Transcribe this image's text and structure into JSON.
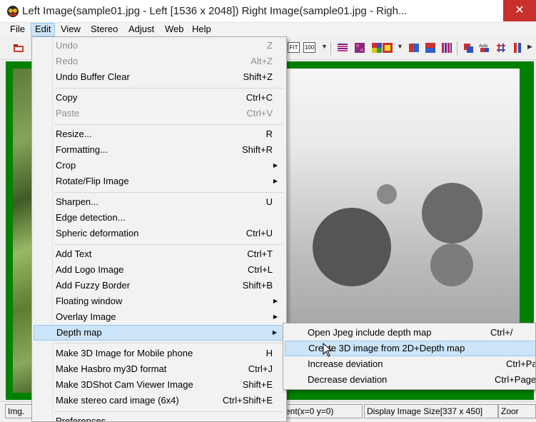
{
  "window": {
    "title": "Left Image(sample01.jpg - Left [1536 x 2048]) Right Image(sample01.jpg - Righ...",
    "close_glyph": "✕"
  },
  "menubar": [
    "File",
    "Edit",
    "View",
    "Stereo",
    "Adjust",
    "Web",
    "Help"
  ],
  "toolbar": {
    "fit_label": "FIT",
    "hundred_label": "100"
  },
  "edit_menu": [
    {
      "label": "Undo",
      "shortcut": "Z",
      "disabled": true
    },
    {
      "label": "Redo",
      "shortcut": "Alt+Z",
      "disabled": true
    },
    {
      "label": "Undo Buffer Clear",
      "shortcut": "Shift+Z"
    },
    {
      "label": "Copy",
      "shortcut": "Ctrl+C"
    },
    {
      "label": "Paste",
      "shortcut": "Ctrl+V",
      "disabled": true
    },
    {
      "label": "Resize...",
      "shortcut": "R"
    },
    {
      "label": "Formatting...",
      "shortcut": "Shift+R"
    },
    {
      "label": "Crop",
      "submenu": true
    },
    {
      "label": "Rotate/Flip Image",
      "submenu": true
    },
    {
      "label": "Sharpen...",
      "shortcut": "U"
    },
    {
      "label": "Edge detection..."
    },
    {
      "label": "Spheric deformation",
      "shortcut": "Ctrl+U"
    },
    {
      "label": "Add Text",
      "shortcut": "Ctrl+T"
    },
    {
      "label": "Add Logo Image",
      "shortcut": "Ctrl+L"
    },
    {
      "label": "Add Fuzzy Border",
      "shortcut": "Shift+B"
    },
    {
      "label": "Floating window",
      "submenu": true
    },
    {
      "label": "Overlay Image",
      "submenu": true
    },
    {
      "label": "Depth map",
      "submenu": true,
      "highlighted": true
    },
    {
      "label": "Make 3D Image for Mobile phone",
      "shortcut": "H"
    },
    {
      "label": "Make Hasbro my3D format",
      "shortcut": "Ctrl+J"
    },
    {
      "label": "Make 3DShot Cam Viewer Image",
      "shortcut": "Shift+E"
    },
    {
      "label": "Make stereo card image (6x4)",
      "shortcut": "Ctrl+Shift+E"
    },
    {
      "label": "Preferences"
    }
  ],
  "depth_submenu": [
    {
      "label": "Open Jpeg include depth map",
      "shortcut": "Ctrl+/"
    },
    {
      "label": "Create 3D image from 2D+Depth map",
      "shortcut": "/",
      "highlighted": true
    },
    {
      "label": "Increase deviation",
      "shortcut": "Ctrl+Pa"
    },
    {
      "label": "Decrease deviation",
      "shortcut": "Ctrl+Page"
    }
  ],
  "status": {
    "left_cell": "Img.",
    "mid_cell": "ent(x=0 y=0)",
    "size_cell": "Display Image Size[337 x 450]",
    "zoom_cell": "Zoor"
  },
  "colors": {
    "accent_highlight": "#cce4f7",
    "highlight_border": "#99c9ef",
    "frame_green": "#008000",
    "close_red": "#c7302b"
  }
}
